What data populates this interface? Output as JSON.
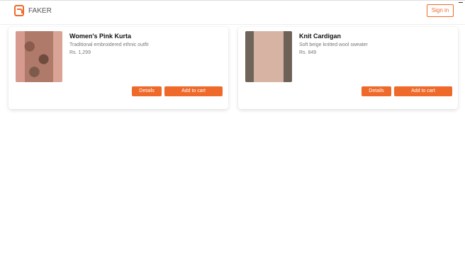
{
  "header": {
    "brand": "FAKER",
    "login_label": "Sign in"
  },
  "cards": [
    {
      "title": "Women's Pink Kurta",
      "description": "Traditional embroidered ethnic outfit",
      "price": "Rs. 1,299",
      "detail_button": "Details",
      "buy_button": "Add to cart"
    },
    {
      "title": "Knit Cardigan",
      "description": "Soft beige knitted wool sweater",
      "price": "Rs. 849",
      "detail_button": "Details",
      "buy_button": "Add to cart"
    }
  ],
  "colors": {
    "accent": "#ef6a2a"
  }
}
